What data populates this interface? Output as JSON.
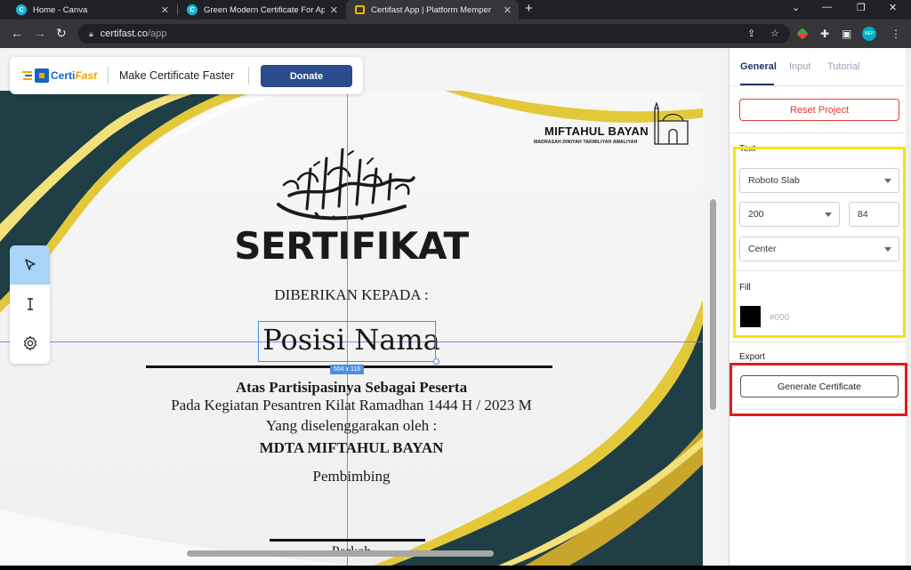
{
  "browser": {
    "tabs": [
      {
        "title": "Home - Canva",
        "icon": "canva-icon"
      },
      {
        "title": "Green Modern Certificate For Ap",
        "icon": "canva-icon"
      },
      {
        "title": "Certifast App | Platform Memper",
        "icon": "certifast-icon"
      }
    ],
    "url_host": "certifast.co",
    "url_path": "/app",
    "profile_initials": "MEP"
  },
  "header": {
    "brand_a": "Certi",
    "brand_b": "Fast",
    "tagline": "Make Certificate Faster",
    "donate_label": "Donate"
  },
  "tools": [
    {
      "name": "select-tool",
      "icon": "cursor-arrow-icon"
    },
    {
      "name": "text-tool",
      "icon": "text-cursor-icon"
    },
    {
      "name": "settings-tool",
      "icon": "gear-icon"
    }
  ],
  "certificate": {
    "school_name": "MIFTAHUL BAYAN",
    "school_subtitle": "MADRASAH DINIYAH TAKMILIYAH AWALIYAH",
    "title": "SERTIFIKAT",
    "given_to": "DIBERIKAN KEPADA :",
    "name_placeholder": "Posisi Nama",
    "name_box_size": "504 x 118",
    "line1": "Atas Partisipasinya Sebagai Peserta",
    "line2": "Pada Kegiatan Pesantren Kilat Ramadhan 1444 H / 2023 M",
    "line3": "Yang diselenggarakan oleh :",
    "organizer": "MDTA MIFTAHUL BAYAN",
    "supervisor_label": "Pembimbing",
    "signatory": "Parkah"
  },
  "panel": {
    "tabs": [
      "General",
      "Input",
      "Tutorial"
    ],
    "active_tab": "General",
    "reset_label": "Reset Project",
    "text_section_label": "Text",
    "font_family": "Roboto Slab",
    "font_weight": "200",
    "font_size": "84",
    "alignment": "Center",
    "fill_section_label": "Fill",
    "fill_hex": "#000",
    "export_section_label": "Export",
    "generate_label": "Generate Certificate"
  },
  "colors": {
    "accent": "#2b4c8c",
    "reset_red": "#e53935",
    "highlight_yellow": "#f5e400",
    "highlight_red": "#e21b1b",
    "deco_teal": "#1f3e45",
    "deco_gold": "#e3c93a"
  }
}
